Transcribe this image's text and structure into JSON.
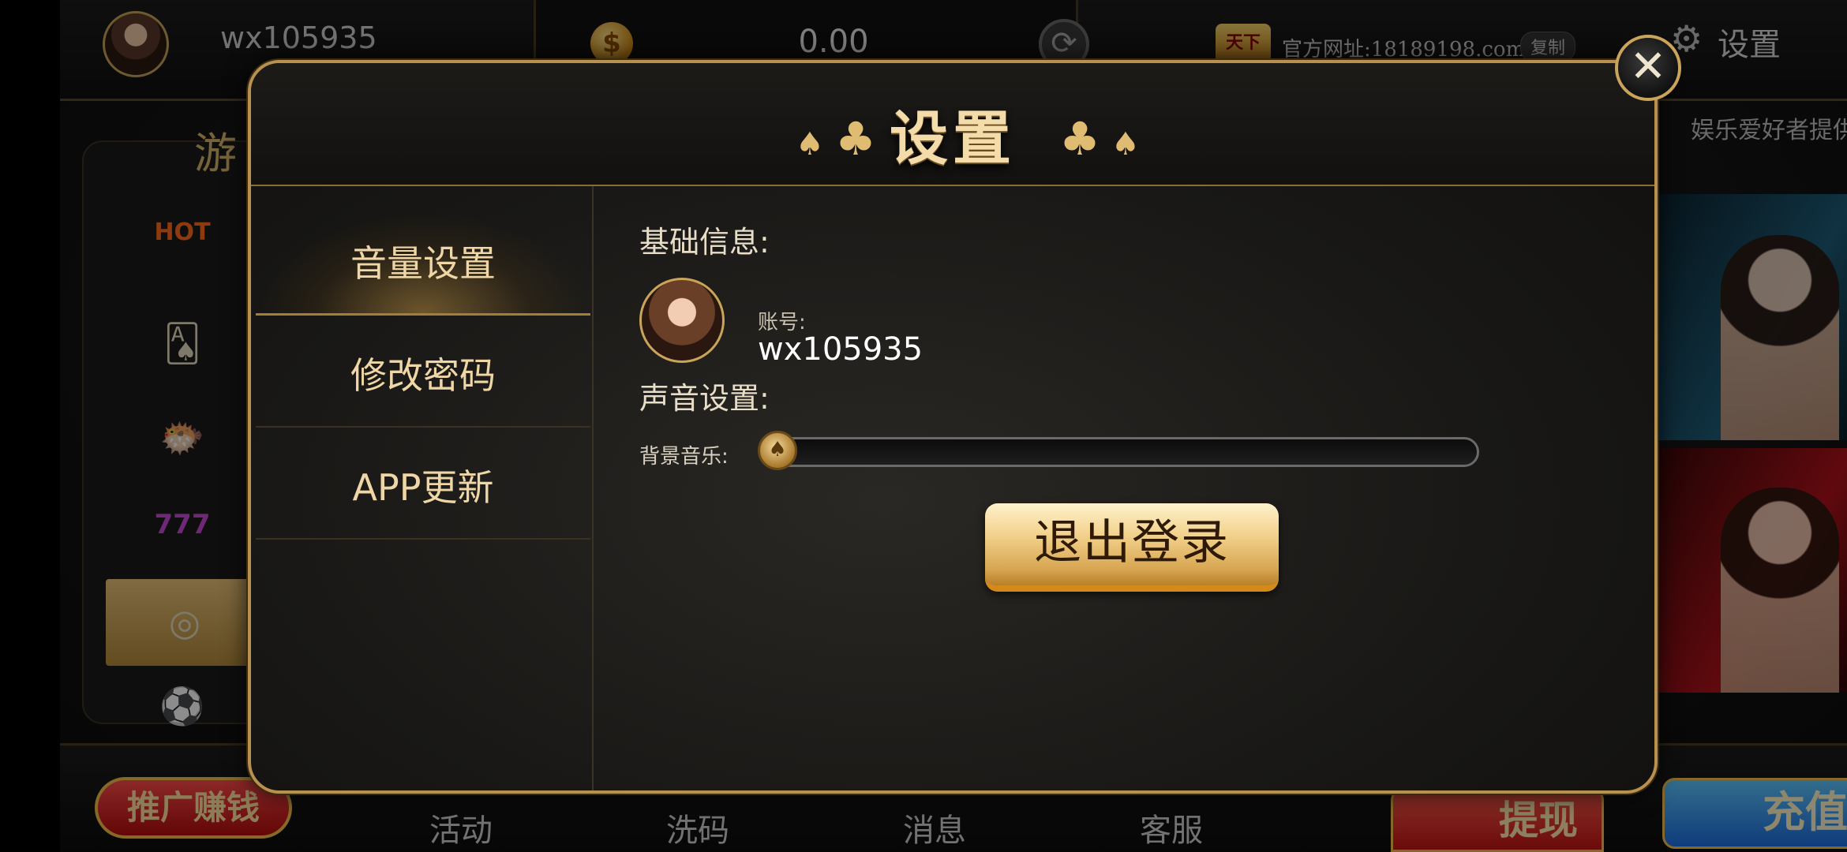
{
  "topbar": {
    "username": "wx105935",
    "balance": "0.00",
    "site_url": "官方网址:18189198.com",
    "copy_label": "复制",
    "settings_label": "设置",
    "logo_text": "天下"
  },
  "background": {
    "left_title": "游",
    "marquee": "娱乐爱好者提供",
    "hot_label": "HOT",
    "promo_label": "推广赚钱",
    "nav": [
      "活动",
      "洗码",
      "消息",
      "客服"
    ],
    "withdraw_label": "提现",
    "recharge_label": "充值"
  },
  "dialog": {
    "title": "设置",
    "close_glyph": "✕",
    "side_items": [
      {
        "label": "音量设置",
        "active": true
      },
      {
        "label": "修改密码",
        "active": false
      },
      {
        "label": "APP更新",
        "active": false
      }
    ],
    "basic_info_label": "基础信息:",
    "account_label": "账号:",
    "account_value": "wx105935",
    "sound_label": "声音设置:",
    "music_label": "背景音乐:",
    "music_volume": 0.0,
    "logout_label": "退出登录"
  },
  "icons": {
    "club": "♣",
    "spade": "♠",
    "coin": "$",
    "refresh": "⟳",
    "gear": "⚙"
  },
  "colors": {
    "accent_gold": "#c9a45a",
    "title_gold": "#f3dcaa",
    "recharge_blue": "#1c6ee0",
    "withdraw_red": "#c21414"
  }
}
